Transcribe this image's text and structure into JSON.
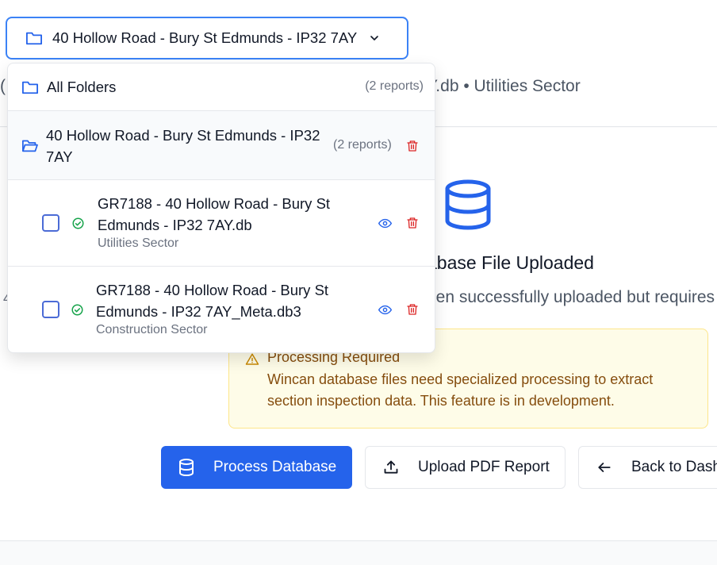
{
  "folder_selector": {
    "selected": "40 Hollow Road - Bury St Edmunds - IP32 7AY"
  },
  "dropdown": {
    "all_folders": {
      "label": "All Folders",
      "count": "(2 reports)"
    },
    "folder": {
      "label": "40 Hollow Road - Bury St Edmunds - IP32 7AY",
      "count": "(2 reports)"
    },
    "reports": [
      {
        "name": "GR7188 - 40 Hollow Road - Bury St Edmunds - IP32 7AY.db",
        "sector": "Utilities Sector",
        "checked": false,
        "status": "complete"
      },
      {
        "name": "GR7188 - 40 Hollow Road - Bury St Edmunds - IP32 7AY_Meta.db3",
        "sector": "Construction Sector",
        "checked": false,
        "status": "complete"
      }
    ]
  },
  "page": {
    "subtitle_left": "(",
    "subtitle_visible": "Y.db • Utilities Sector",
    "heading_visible": "abase File Uploaded",
    "description_visible": "een successfully uploaded but requires",
    "left_glyph": "4"
  },
  "notice": {
    "title": "Processing Required",
    "text": "Wincan database files need specialized processing to extract section inspection data. This feature is in development."
  },
  "actions": {
    "process": "Process Database",
    "upload": "Upload PDF Report",
    "back": "Back to Dash"
  },
  "colors": {
    "primary": "#2563eb",
    "danger": "#dc2626",
    "success": "#16a34a",
    "warning_bg": "#fefce8",
    "warning_text": "#854d0e"
  },
  "icons": {
    "folder": "folder-icon",
    "folder_open": "folder-open-icon",
    "chevron": "chevron-down-icon",
    "database": "database-icon",
    "trash": "trash-icon",
    "eye": "eye-icon",
    "check_circle": "check-circle-icon",
    "warning": "warning-triangle-icon",
    "upload": "upload-icon",
    "arrow_left": "arrow-left-icon"
  }
}
